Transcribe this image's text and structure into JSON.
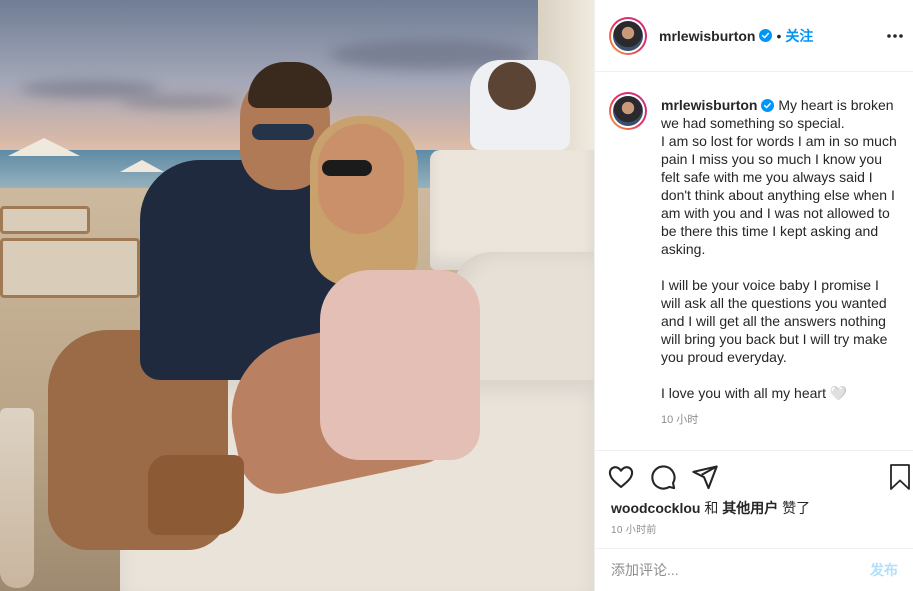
{
  "post": {
    "username": "mrlewisburton",
    "follow_label": "关注",
    "dot": "•",
    "caption": "My heart is broken we had something so special.\nI am so lost for words I am in so much pain I miss you so much I know you felt safe with me you always said I don't think about anything else when I am with you and I was not allowed to be there this time I kept asking and asking.\n\nI will be your voice baby I promise I will ask all the questions you wanted and I will get all the answers nothing will bring you back but I will try make you proud everyday.\n\nI love you with all my heart 🤍",
    "caption_time": "10 小时",
    "liked_by_user": "woodcocklou",
    "liked_by_rest": " 和 ",
    "liked_by_others": "其他用户",
    "liked_suffix": " 赞了",
    "post_time": "10 小时前",
    "comment_placeholder": "添加评论...",
    "post_button": "发布"
  },
  "icons": {
    "verified": "verified-badge-icon",
    "more": "more-options-icon",
    "like": "heart-icon",
    "comment": "comment-icon",
    "share": "share-icon",
    "save": "bookmark-icon"
  },
  "colors": {
    "accent": "#0095f6",
    "post_disabled": "#b2dffc",
    "secondary_text": "#8e8e8e",
    "border": "#efefef"
  }
}
